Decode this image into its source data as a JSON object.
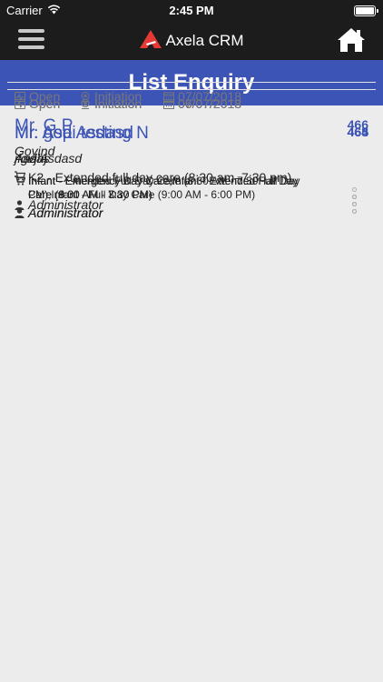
{
  "status_bar": {
    "carrier": "Carrier",
    "time": "2:45 PM"
  },
  "nav": {
    "brand": "Axela CRM"
  },
  "header": {
    "title": "List Enquiry"
  },
  "enquiries": [
    {
      "name": "Mr. G P",
      "number": "466",
      "subtitle": "Govind",
      "service": "K2 - Extended full day care (8:30 am–7:30 pm)",
      "user": "Administrator",
      "status": "Open",
      "stage": "Initiation",
      "date": "07/07/2018"
    },
    {
      "name": "Mr. gopi testing N",
      "number": "465",
      "subtitle": "jfgvjhj",
      "service": "Infant - Emergency Day Care,Infant - Extended Full Day Care (8:30 AM - 7:30 PM)",
      "user": "Administrator",
      "status": "Open",
      "stage": "Initiation",
      "date": "07/07/2018"
    },
    {
      "name": "Mr. Asa",
      "number": "464",
      "subtitle": "Aasas",
      "service": "Infant - Emergency Day Care,Infant - Extended Half Day Care (9:00 AM - 3:30 PM)",
      "user": "Administrator",
      "status": "Open",
      "stage": "Initiation",
      "date": "06/07/2018"
    },
    {
      "name": "Mr. Asd Asdasd",
      "number": "463",
      "subtitle": "Asd Asdasd",
      "service": "Infant - Extended Full Day Care (8:30 AM - 7:30 PM),Infant - Full Day Care (9:00 AM - 6:00 PM)",
      "user": "Administrator",
      "status": "Open",
      "stage": "Initiation",
      "date": "06/07/2018"
    }
  ],
  "colors": {
    "accent": "#3d54b7",
    "bar": "#1c1c1c",
    "logo": "#e53935"
  }
}
